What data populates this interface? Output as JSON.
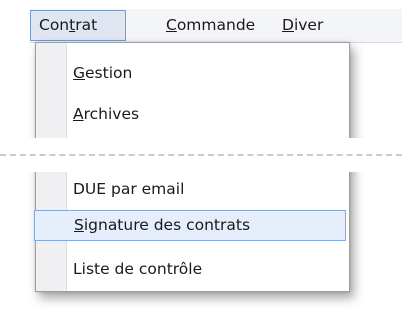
{
  "menubar": {
    "items": [
      {
        "pre": "Con",
        "mn": "t",
        "post": "rat"
      },
      {
        "pre": "",
        "mn": "C",
        "post": "ommande"
      },
      {
        "pre": "",
        "mn": "D",
        "post": "iver"
      }
    ]
  },
  "dropdown": {
    "items": [
      {
        "pre": "",
        "mn": "G",
        "post": "estion"
      },
      {
        "pre": "",
        "mn": "A",
        "post": "rchives"
      },
      {
        "pre": "",
        "mn": "",
        "post": "DUE par email"
      },
      {
        "pre": "",
        "mn": "S",
        "post": "ignature des contrats"
      },
      {
        "pre": "",
        "mn": "",
        "post": "Liste de contrôle"
      }
    ]
  }
}
